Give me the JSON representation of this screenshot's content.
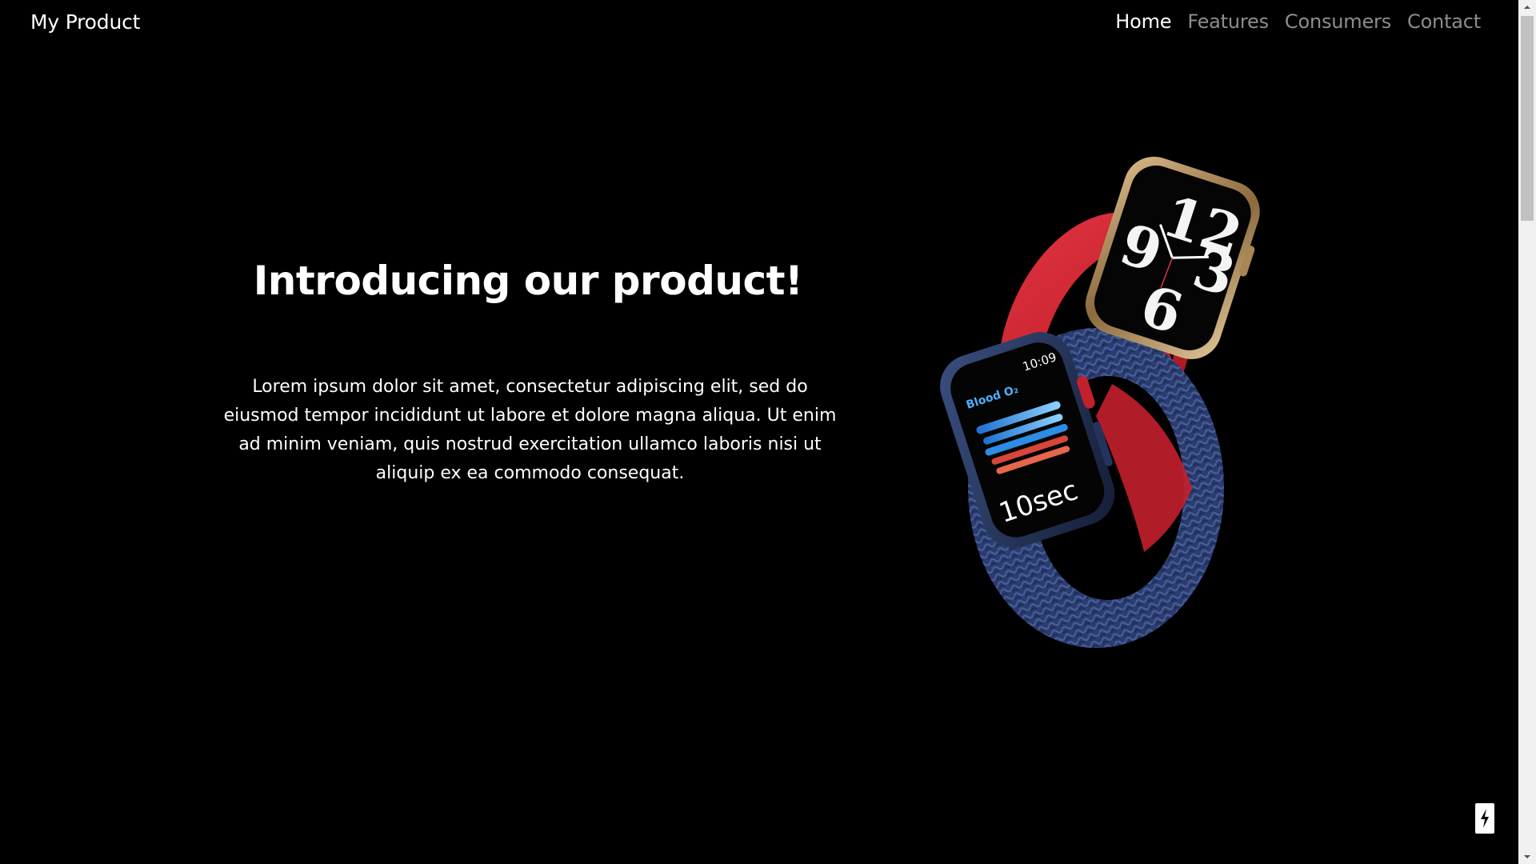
{
  "navbar": {
    "brand": "My Product",
    "links": [
      {
        "label": "Home",
        "active": true
      },
      {
        "label": "Features",
        "active": false
      },
      {
        "label": "Consumers",
        "active": false
      },
      {
        "label": "Contact",
        "active": false
      }
    ]
  },
  "hero": {
    "title": "Introducing our product!",
    "text": "Lorem ipsum dolor sit amet, consectetur adipiscing elit, sed do eiusmod tempor incididunt ut labore et dolore magna aliqua. Ut enim ad minim veniam, quis nostrud exercitation ullamco laboris nisi ut aliquip ex ea commodo consequat."
  },
  "product_image": {
    "front_watch": {
      "time": "10:09",
      "label": "Blood O₂",
      "readout": "10sec"
    },
    "back_watch": {
      "dial": "12 9 3 6"
    },
    "colors": {
      "red_band": "#c8202e",
      "blue_band": "#2b3d6e",
      "gold_case": "#b08d57",
      "blue_case": "#1f2c4d"
    }
  },
  "badge": {
    "icon": "bolt-icon"
  },
  "colors": {
    "background": "#000000",
    "text": "#ffffff",
    "nav_inactive": "#8c8c8c"
  }
}
